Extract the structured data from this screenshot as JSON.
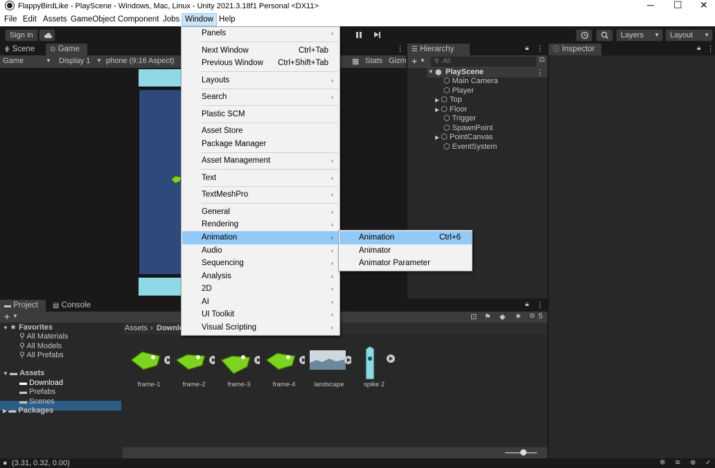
{
  "window": {
    "title": "FlappyBirdLike - PlayScene - Windows, Mac, Linux - Unity 2021.3.18f1 Personal <DX11>",
    "controls": {
      "minimize": "─",
      "maximize": "☐",
      "close": "✕"
    }
  },
  "menubar": [
    "File",
    "Edit",
    "Assets",
    "GameObject",
    "Component",
    "Jobs",
    "Window",
    "Help"
  ],
  "toolbar": {
    "sign_in": "Sign in",
    "layers": "Layers",
    "layout": "Layout"
  },
  "scene_panel": {
    "tabs": [
      "Scene",
      "Game"
    ],
    "game_mode": "Game",
    "display": "Display 1",
    "aspect": "phone (9:16 Aspect)",
    "stats": "Stats",
    "gizmos": "Gizm"
  },
  "hierarchy": {
    "tab": "Hierarchy",
    "search_placeholder": "All",
    "scene": "PlayScene",
    "items": [
      "Main Camera",
      "Player",
      "Top",
      "Floor",
      "Trigger",
      "SpawnPoint",
      "PointCanvas",
      "EventSystem"
    ]
  },
  "inspector": {
    "tab": "Inspector"
  },
  "project": {
    "tabs": [
      "Project",
      "Console"
    ],
    "favorites": "Favorites",
    "favorite_items": [
      "All Materials",
      "All Models",
      "All Prefabs"
    ],
    "assets": "Assets",
    "asset_folders": [
      "Download",
      "Prefabs",
      "Scenes"
    ],
    "packages": "Packages",
    "breadcrumb_root": "Assets",
    "breadcrumb_sep": "›",
    "breadcrumb_current": "Downlo",
    "hidden_count": "5",
    "files": [
      "frame-1",
      "frame-2",
      "frame-3",
      "frame-4",
      "landscape",
      "spike 2"
    ]
  },
  "window_menu": {
    "items": [
      {
        "label": "Panels",
        "arrow": "›"
      },
      {
        "label": "Next Window",
        "shortcut": "Ctrl+Tab"
      },
      {
        "label": "Previous Window",
        "shortcut": "Ctrl+Shift+Tab"
      },
      {
        "label": "Layouts",
        "arrow": "›"
      },
      {
        "label": "Search",
        "arrow": "›"
      },
      {
        "label": "Plastic SCM"
      },
      {
        "label": "Asset Store"
      },
      {
        "label": "Package Manager"
      },
      {
        "label": "Asset Management",
        "arrow": "›"
      },
      {
        "label": "Text",
        "arrow": "›"
      },
      {
        "label": "TextMeshPro",
        "arrow": "›"
      },
      {
        "label": "General",
        "arrow": "›"
      },
      {
        "label": "Rendering",
        "arrow": "›"
      },
      {
        "label": "Animation",
        "arrow": "›"
      },
      {
        "label": "Audio",
        "arrow": "›"
      },
      {
        "label": "Sequencing",
        "arrow": "›"
      },
      {
        "label": "Analysis",
        "arrow": "›"
      },
      {
        "label": "2D",
        "arrow": "›"
      },
      {
        "label": "AI",
        "arrow": "›"
      },
      {
        "label": "UI Toolkit",
        "arrow": "›"
      },
      {
        "label": "Visual Scripting",
        "arrow": "›"
      }
    ]
  },
  "animation_submenu": {
    "items": [
      {
        "label": "Animation",
        "shortcut": "Ctrl+6"
      },
      {
        "label": "Animator"
      },
      {
        "label": "Animator Parameter"
      }
    ]
  },
  "status": {
    "coords": "(3.31, 0.32, 0.00)"
  },
  "colors": {
    "menu_highlight": "#91c9f7",
    "selection": "#2c5d87",
    "game_bg": "#2e4a7a",
    "sky": "#8fd9e6",
    "bird": "#7ed321"
  }
}
